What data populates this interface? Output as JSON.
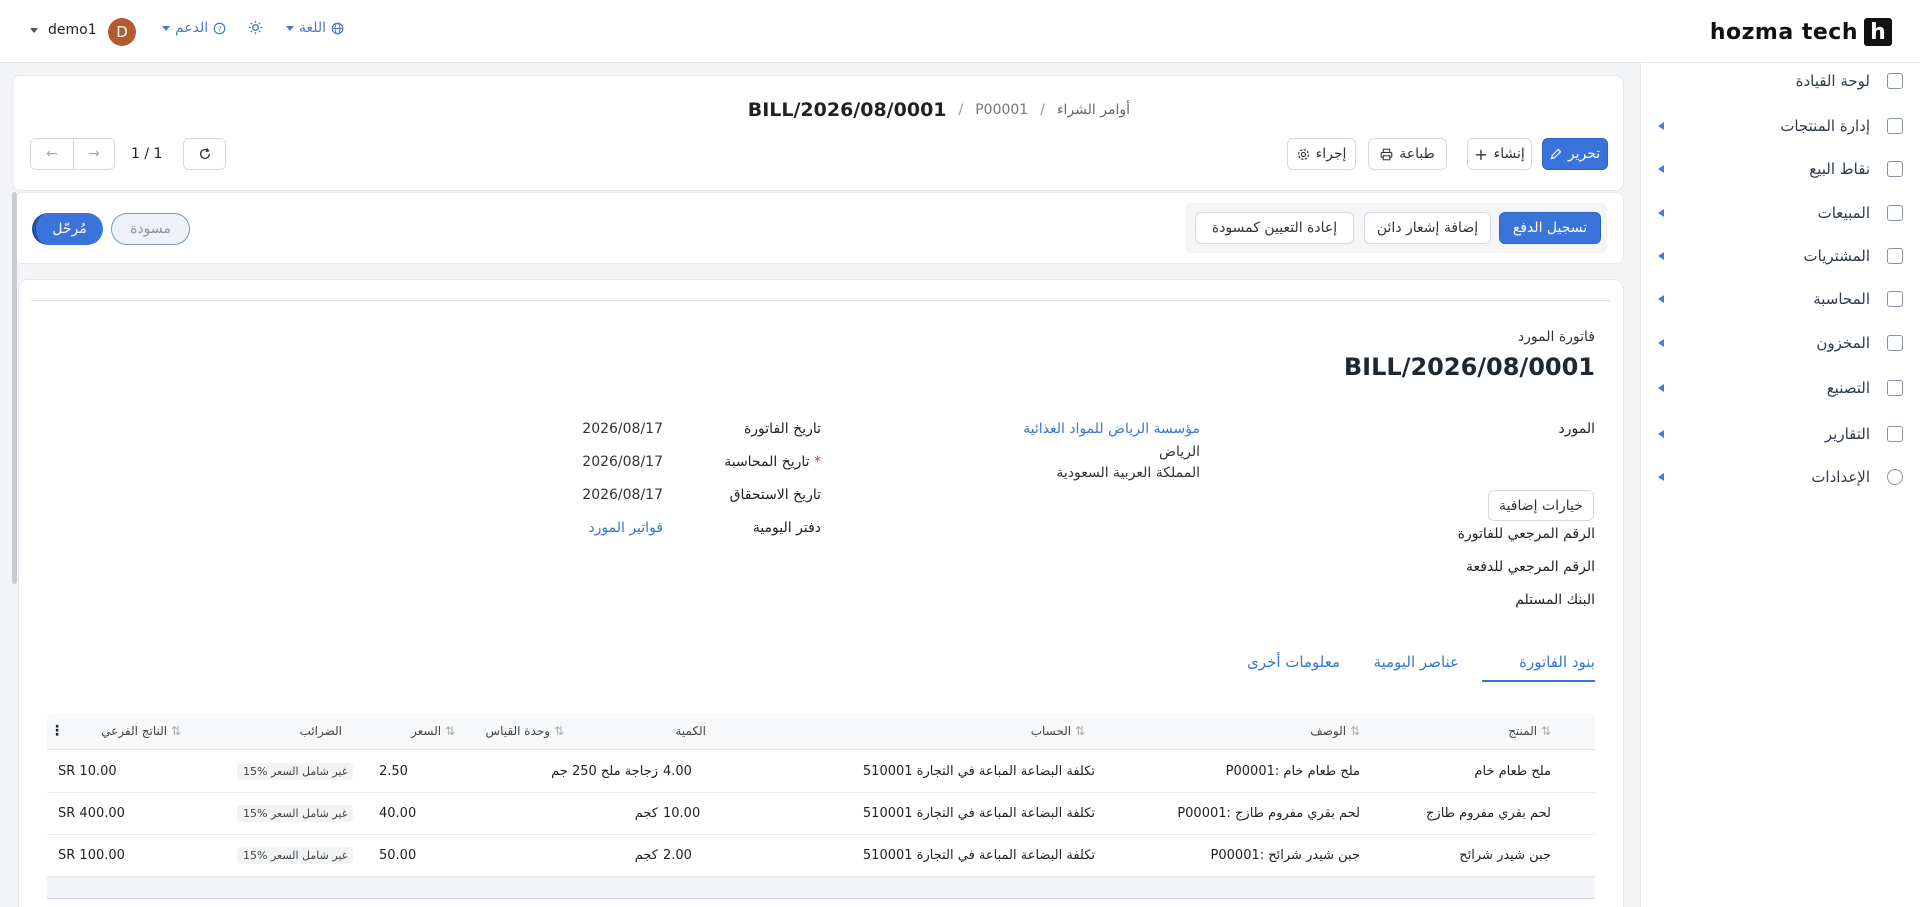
{
  "header": {
    "logo_mark": "h",
    "logo_text": "hozma tech",
    "language_label": "اللغة",
    "support_label": "الدعم",
    "user_name": "demo1",
    "avatar_initial": "D"
  },
  "sidebar": {
    "items": [
      {
        "label": "لوحة القيادة",
        "has_arrow": false
      },
      {
        "label": "إدارة المنتجات",
        "has_arrow": true
      },
      {
        "label": "نقاط البيع",
        "has_arrow": true
      },
      {
        "label": "المبيعات",
        "has_arrow": true
      },
      {
        "label": "المشتريات",
        "has_arrow": true
      },
      {
        "label": "المحاسبة",
        "has_arrow": true
      },
      {
        "label": "المخزون",
        "has_arrow": true
      },
      {
        "label": "التصنيع",
        "has_arrow": true
      },
      {
        "label": "التقارير",
        "has_arrow": true
      },
      {
        "label": "الإعدادات",
        "has_arrow": true
      }
    ]
  },
  "breadcrumb": {
    "root": "أوامر الشراء",
    "parent": "P00001",
    "current": "BILL/2026/08/0001"
  },
  "toolbar": {
    "edit_label": "تحرير",
    "create_label": "إنشاء",
    "print_label": "طباعة",
    "action_label": "إجراء",
    "pager": "1 / 1"
  },
  "status_bar": {
    "register_payment": "تسجيل الدفع",
    "add_credit_note": "إضافة إشعار دائن",
    "reset_to_draft": "إعادة التعيين كمسودة",
    "status_draft": "مسودة",
    "status_posted": "مُرحّل"
  },
  "document": {
    "type_label": "فاتورة المورد",
    "number": "BILL/2026/08/0001",
    "vendor_label": "المورد",
    "vendor_name": "مؤسسة الرياض للمواد الغذائية",
    "vendor_city": "الرياض",
    "vendor_country": "المملكة العربية السعودية",
    "bill_date_label": "تاريخ الفاتورة",
    "bill_date": "2026/08/17",
    "accounting_date_label": "تاريخ المحاسبة",
    "accounting_date": "2026/08/17",
    "due_date_label": "تاريخ الاستحقاق",
    "due_date": "2026/08/17",
    "journal_label": "دفتر اليومية",
    "journal": "فواتير المورد",
    "more_options": "خيارات إضافية",
    "bill_reference_label": "الرقم المرجعي للفاتورة",
    "payment_reference_label": "الرقم المرجعي للدفعة",
    "recipient_bank_label": "البنك المستلم"
  },
  "tabs": [
    "بنود الفاتورة",
    "عناصر اليومية",
    "معلومات أخرى"
  ],
  "table": {
    "headers": {
      "product": "المنتج",
      "description": "الوصف",
      "account": "الحساب",
      "quantity": "الكمية",
      "uom": "وحدة القياس",
      "price": "السعر",
      "taxes": "الضرائب",
      "subtotal": "الناتج الفرعي"
    },
    "rows": [
      {
        "product": "ملح طعام خام",
        "description": "P00001: ملح طعام خام",
        "account": "510001 تكلفة البضاعة المباعة في التجارة",
        "quantity": "4.00",
        "uom": "زجاجة ملح 250 جم",
        "price": "2.50",
        "tax": "15% غير شامل السعر",
        "subtotal": "SR 10.00"
      },
      {
        "product": "لحم بقري مفروم طازج",
        "description": "P00001: لحم بقري مفروم طازج",
        "account": "510001 تكلفة البضاعة المباعة في التجارة",
        "quantity": "10.00",
        "uom": "كجم",
        "price": "40.00",
        "tax": "15% غير شامل السعر",
        "subtotal": "SR 400.00"
      },
      {
        "product": "جبن شيدر شرائح",
        "description": "P00001: جبن شيدر شرائح",
        "account": "510001 تكلفة البضاعة المباعة في التجارة",
        "quantity": "2.00",
        "uom": "كجم",
        "price": "50.00",
        "tax": "15% غير شامل السعر",
        "subtotal": "SR 100.00"
      }
    ]
  },
  "colors": {
    "accent": "#3a73d9",
    "avatar": "#b35a2e"
  }
}
